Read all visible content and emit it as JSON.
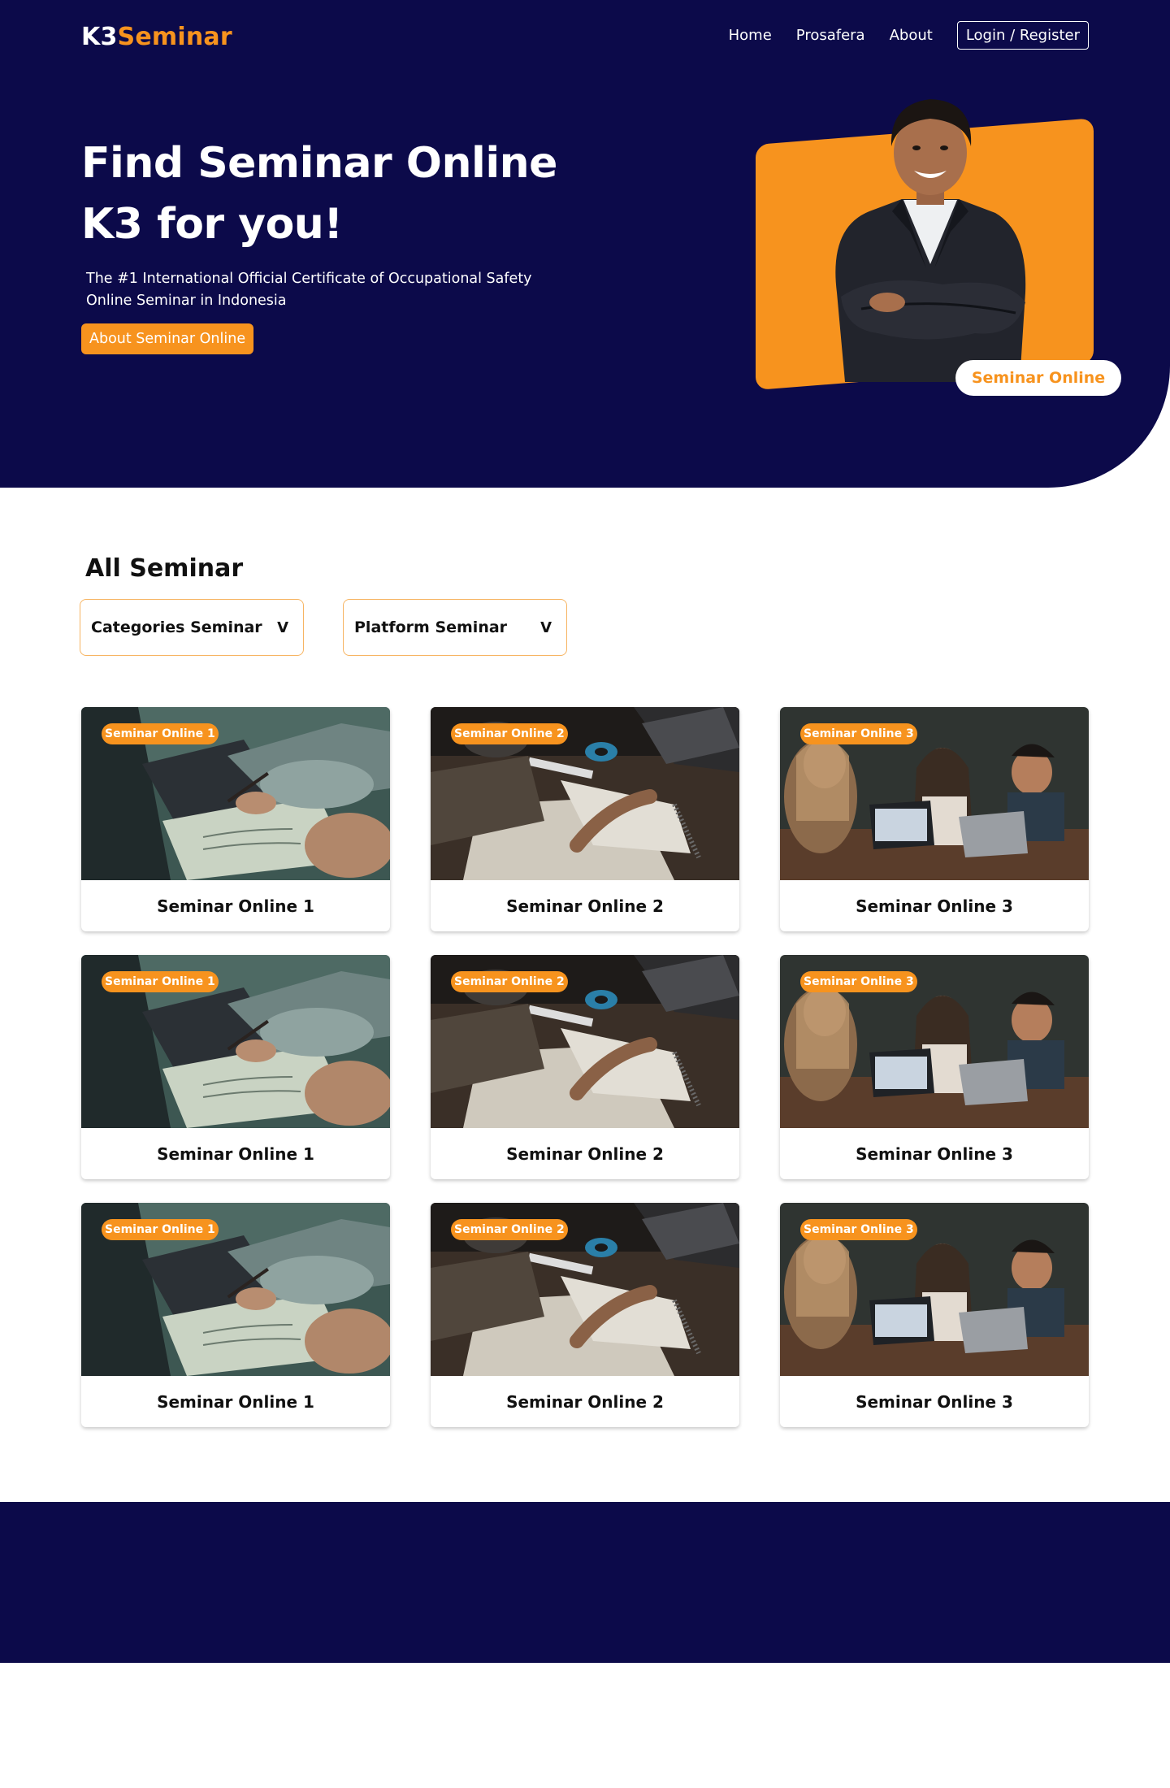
{
  "brand": {
    "part1": "K3",
    "part2": "Seminar"
  },
  "nav": {
    "home": "Home",
    "prosafera": "Prosafera",
    "about": "About",
    "login": "Login / Register"
  },
  "hero": {
    "title_line1": "Find Seminar Online",
    "title_line2": "K3 for you!",
    "subtitle_line1": "The #1 International Official Certificate of Occupational Safety",
    "subtitle_line2": "Online Seminar in Indonesia",
    "button": "About Seminar Online",
    "pill": "Seminar Online"
  },
  "section": {
    "title": "All Seminar"
  },
  "filters": {
    "categories": {
      "label": "Categories Seminar",
      "chevron": "V"
    },
    "platform": {
      "label": "Platform Seminar",
      "chevron": "V"
    }
  },
  "cards": [
    {
      "badge": "Seminar Online 1",
      "title": "Seminar Online 1",
      "image": "writing-notes-laptop"
    },
    {
      "badge": "Seminar Online 2",
      "title": "Seminar Online 2",
      "image": "desk-notebook-keyboard"
    },
    {
      "badge": "Seminar Online 3",
      "title": "Seminar Online 3",
      "image": "people-meeting-laptop"
    },
    {
      "badge": "Seminar Online 1",
      "title": "Seminar Online 1",
      "image": "writing-notes-laptop"
    },
    {
      "badge": "Seminar Online 2",
      "title": "Seminar Online 2",
      "image": "desk-notebook-keyboard"
    },
    {
      "badge": "Seminar Online 3",
      "title": "Seminar Online 3",
      "image": "people-meeting-laptop"
    },
    {
      "badge": "Seminar Online 1",
      "title": "Seminar Online 1",
      "image": "writing-notes-laptop"
    },
    {
      "badge": "Seminar Online 2",
      "title": "Seminar Online 2",
      "image": "desk-notebook-keyboard"
    },
    {
      "badge": "Seminar Online 3",
      "title": "Seminar Online 3",
      "image": "people-meeting-laptop"
    }
  ],
  "colors": {
    "navy": "#0c0a4a",
    "orange": "#f7931e",
    "white": "#ffffff"
  }
}
